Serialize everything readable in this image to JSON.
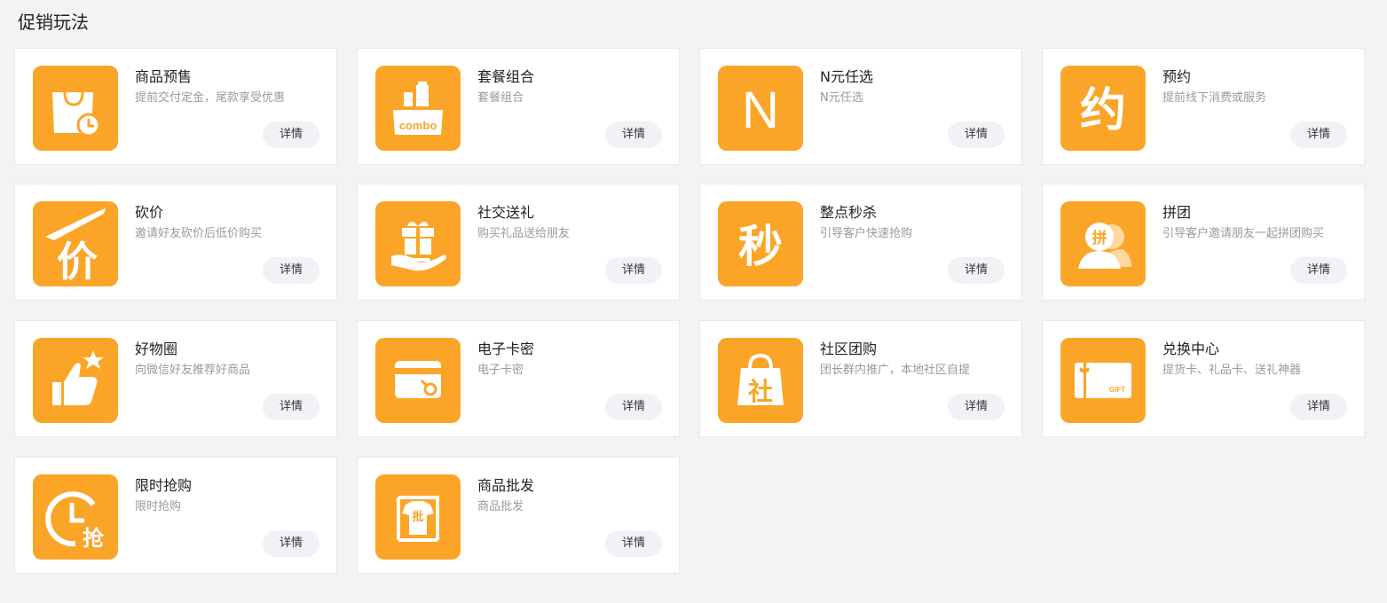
{
  "page": {
    "title": "促销玩法"
  },
  "theme": {
    "tile_color": "#fba528",
    "button_bg": "#f0f2f6"
  },
  "cards": [
    {
      "title": "商品预售",
      "desc": "提前交付定金，尾款享受优惠",
      "button": "详情",
      "icon": "shopping-bag-clock-icon"
    },
    {
      "title": "套餐组合",
      "desc": "套餐组合",
      "button": "详情",
      "icon": "combo-bottles-icon",
      "icon_text": "combo"
    },
    {
      "title": "N元任选",
      "desc": "N元任选",
      "button": "详情",
      "icon": "letter-n-icon",
      "icon_text": "N"
    },
    {
      "title": "预约",
      "desc": "提前线下消费或服务",
      "button": "详情",
      "icon": "reservation-character-icon",
      "icon_text": "约"
    },
    {
      "title": "砍价",
      "desc": "邀请好友砍价后低价购买",
      "button": "详情",
      "icon": "knife-price-icon",
      "icon_text": "价"
    },
    {
      "title": "社交送礼",
      "desc": "购买礼品送给朋友",
      "button": "详情",
      "icon": "gift-hand-icon"
    },
    {
      "title": "整点秒杀",
      "desc": "引导客户快速抢购",
      "button": "详情",
      "icon": "flash-sale-character-icon",
      "icon_text": "秒"
    },
    {
      "title": "拼团",
      "desc": "引导客户邀请朋友一起拼团购买",
      "button": "详情",
      "icon": "group-buy-people-icon",
      "icon_text": "拼"
    },
    {
      "title": "好物圈",
      "desc": "向微信好友推荐好商品",
      "button": "详情",
      "icon": "thumbs-up-star-icon"
    },
    {
      "title": "电子卡密",
      "desc": "电子卡密",
      "button": "详情",
      "icon": "card-key-icon"
    },
    {
      "title": "社区团购",
      "desc": "团长群内推广，本地社区自提",
      "button": "详情",
      "icon": "community-bag-icon",
      "icon_text": "社"
    },
    {
      "title": "兑换中心",
      "desc": "提货卡、礼品卡、送礼神器",
      "button": "详情",
      "icon": "gift-card-icon",
      "icon_text": "GIFT"
    },
    {
      "title": "限时抢购",
      "desc": "限时抢购",
      "button": "详情",
      "icon": "clock-rush-icon",
      "icon_text": "抢"
    },
    {
      "title": "商品批发",
      "desc": "商品批发",
      "button": "详情",
      "icon": "wholesale-shirt-icon",
      "icon_text": "批"
    }
  ]
}
